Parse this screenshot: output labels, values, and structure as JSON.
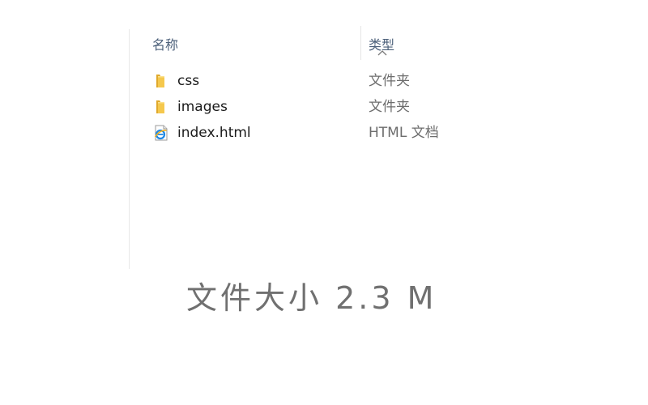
{
  "header": {
    "name_label": "名称",
    "type_label": "类型",
    "sort_direction": "ascending"
  },
  "files": [
    {
      "name": "css",
      "type": "文件夹",
      "icon": "folder-icon"
    },
    {
      "name": "images",
      "type": "文件夹",
      "icon": "folder-icon"
    },
    {
      "name": "index.html",
      "type": "HTML 文档",
      "icon": "html-document-icon"
    }
  ],
  "caption": {
    "size_text": "文件大小 2.3 M"
  },
  "colors": {
    "header_text": "#4c607a",
    "folder_yellow": "#f2c24a",
    "type_text": "#6d6d6d"
  }
}
